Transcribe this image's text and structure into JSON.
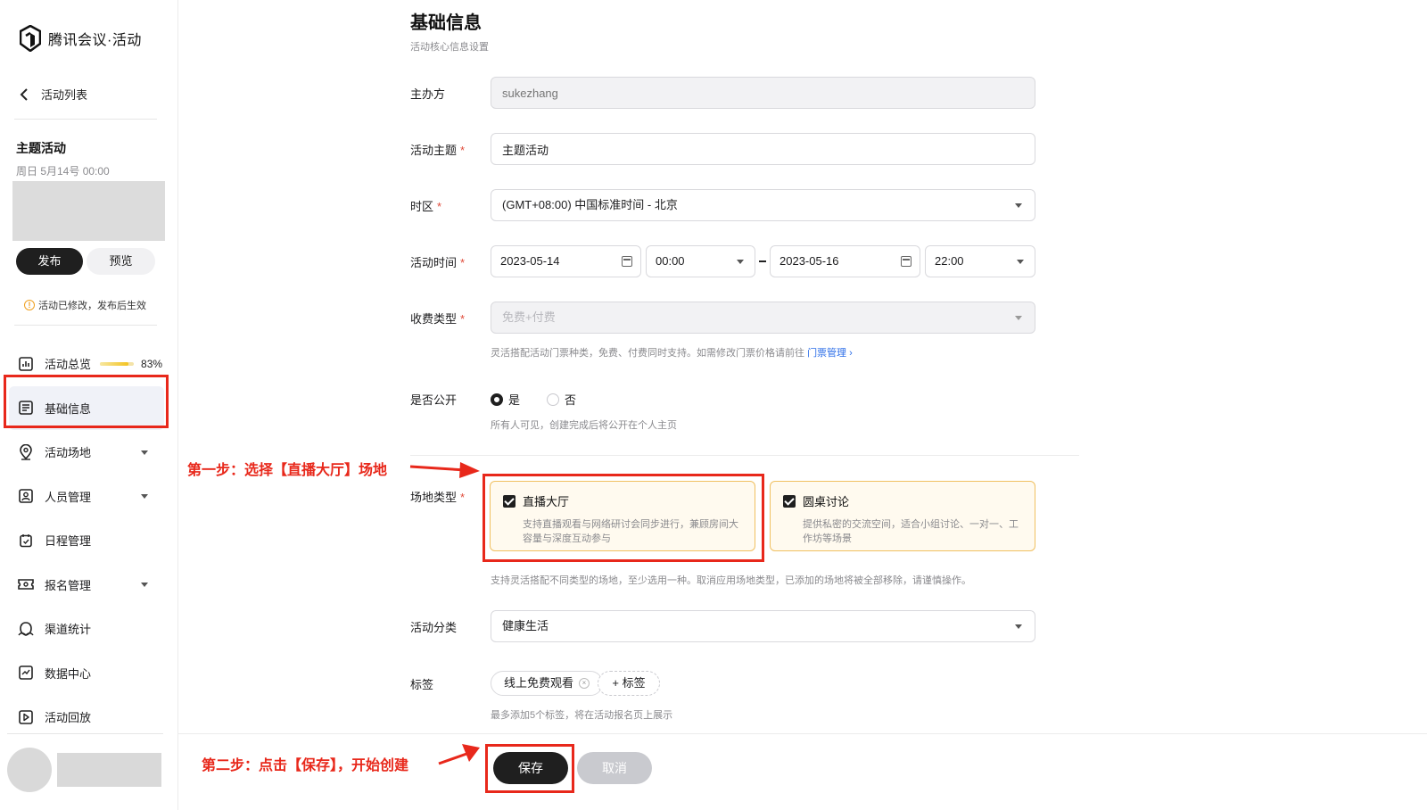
{
  "app": {
    "name": "腾讯会议·活动"
  },
  "sidebar": {
    "back_label": "活动列表",
    "event_title": "主题活动",
    "event_date": "周日  5月14号  00:00",
    "publish_label": "发布",
    "preview_label": "预览",
    "notice": "活动已修改，发布后生效",
    "overview_progress": 0.83,
    "overview_progress_text": "83%",
    "items": [
      {
        "label": "活动总览",
        "icon": "bar-chart-icon"
      },
      {
        "label": "基础信息",
        "icon": "list-icon"
      },
      {
        "label": "活动场地",
        "icon": "location-icon"
      },
      {
        "label": "人员管理",
        "icon": "person-card-icon"
      },
      {
        "label": "日程管理",
        "icon": "calendar-check-icon"
      },
      {
        "label": "报名管理",
        "icon": "ticket-icon"
      },
      {
        "label": "渠道统计",
        "icon": "channel-icon"
      },
      {
        "label": "数据中心",
        "icon": "trend-icon"
      },
      {
        "label": "活动回放",
        "icon": "play-icon"
      }
    ]
  },
  "form": {
    "title": "基础信息",
    "subtitle": "活动核心信息设置",
    "organizer": {
      "label": "主办方",
      "placeholder": "sukezhang"
    },
    "topic": {
      "label": "活动主题",
      "value": "主题活动"
    },
    "timezone": {
      "label": "时区",
      "value": "(GMT+08:00) 中国标准时间 - 北京"
    },
    "time": {
      "label": "活动时间",
      "start_date": "2023-05-14",
      "start_time": "00:00",
      "end_date": "2023-05-16",
      "end_time": "22:00"
    },
    "fee": {
      "label": "收费类型",
      "value": "免费+付费",
      "help": "灵活搭配活动门票种类，免费、付费同时支持。如需修改门票价格请前往",
      "link": "门票管理 ›"
    },
    "public": {
      "label": "是否公开",
      "yes": "是",
      "no": "否",
      "help": "所有人可见，创建完成后将公开在个人主页"
    },
    "venue": {
      "label": "场地类型",
      "cards": [
        {
          "title": "直播大厅",
          "desc": "支持直播观看与网络研讨会同步进行，兼顾房间大容量与深度互动参与"
        },
        {
          "title": "圆桌讨论",
          "desc": "提供私密的交流空间，适合小组讨论、一对一、工作坊等场景"
        }
      ],
      "help": "支持灵活搭配不同类型的场地，至少选用一种。取消应用场地类型，已添加的场地将被全部移除，请谨慎操作。"
    },
    "category": {
      "label": "活动分类",
      "value": "健康生活"
    },
    "tags": {
      "label": "标签",
      "items": [
        "线上免费观看"
      ],
      "add_label": "+ 标签",
      "help": "最多添加5个标签，将在活动报名页上展示"
    },
    "save_label": "保存",
    "cancel_label": "取消"
  },
  "annotations": {
    "step1": "第一步：选择【直播大厅】场地",
    "step2": "第二步：点击【保存】，开始创建"
  }
}
